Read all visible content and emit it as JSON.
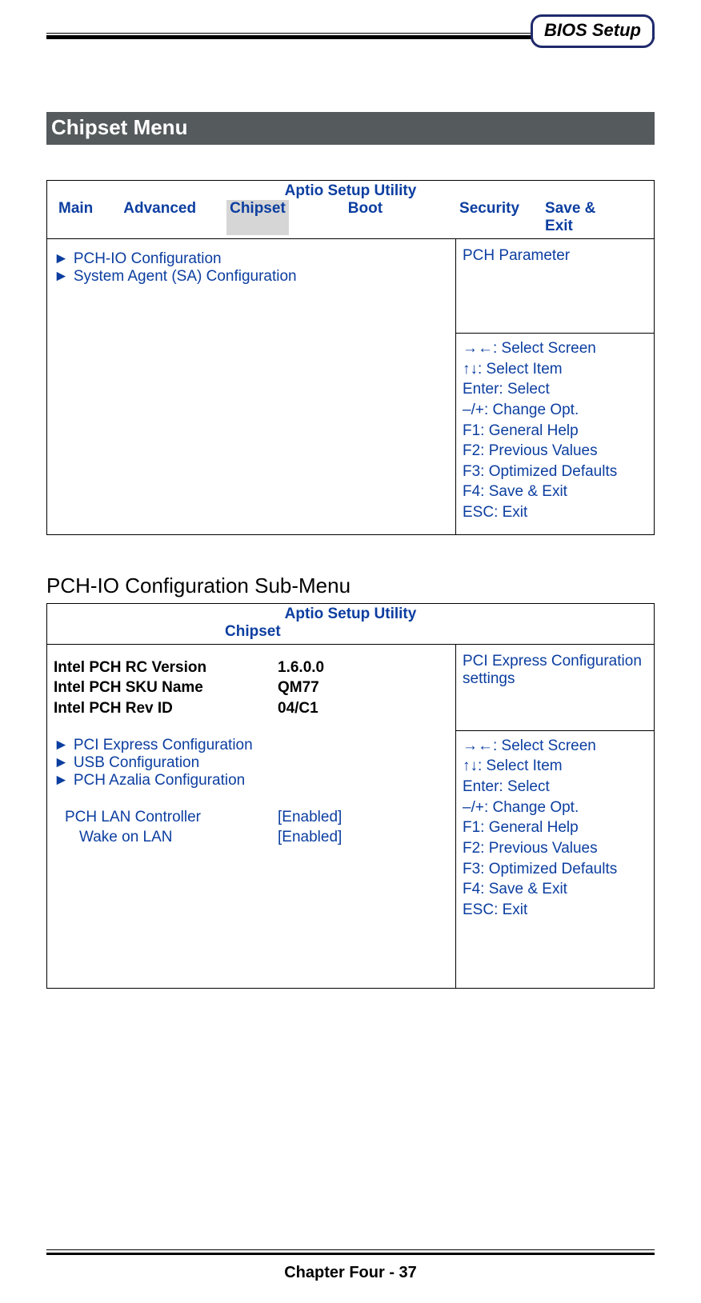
{
  "header": {
    "badge": "BIOS Setup"
  },
  "section_title": "Chipset Menu",
  "panel1": {
    "title": "Aptio Setup Utility",
    "tabs": [
      "Main",
      "Advanced",
      "Chipset",
      "Boot",
      "Security",
      "Save & Exit"
    ],
    "menu_items": [
      "PCH-IO Configuration",
      "System Agent (SA) Configuration"
    ],
    "help_top": "PCH Parameter",
    "help_keys": [
      "→←: Select Screen",
      "↑↓: Select Item",
      "Enter: Select",
      "–/+: Change Opt.",
      "F1: General Help",
      "F2: Previous Values",
      "F3: Optimized Defaults",
      "F4: Save & Exit",
      "ESC: Exit"
    ]
  },
  "sub_title": "PCH-IO Configuration Sub-Menu",
  "panel2": {
    "title": "Aptio Setup Utility",
    "tab": "Chipset",
    "info": [
      {
        "label": "Intel PCH RC Version",
        "value": "1.6.0.0"
      },
      {
        "label": "Intel PCH SKU Name",
        "value": "QM77"
      },
      {
        "label": "Intel PCH Rev ID",
        "value": "04/C1"
      }
    ],
    "submenus": [
      "PCI Express Configuration",
      "USB Configuration",
      "PCH Azalia Configuration"
    ],
    "options": [
      {
        "label": "PCH LAN Controller",
        "value": "[Enabled]",
        "indent": 1
      },
      {
        "label": "Wake on LAN",
        "value": "[Enabled]",
        "indent": 2
      }
    ],
    "help_top": "PCI Express Configuration settings",
    "help_keys": [
      "→←: Select Screen",
      "↑↓: Select Item",
      "Enter: Select",
      "–/+: Change Opt.",
      "F1: General Help",
      "F2: Previous Values",
      "F3: Optimized Defaults",
      "F4: Save & Exit",
      "ESC: Exit"
    ]
  },
  "footer": "Chapter Four - 37"
}
